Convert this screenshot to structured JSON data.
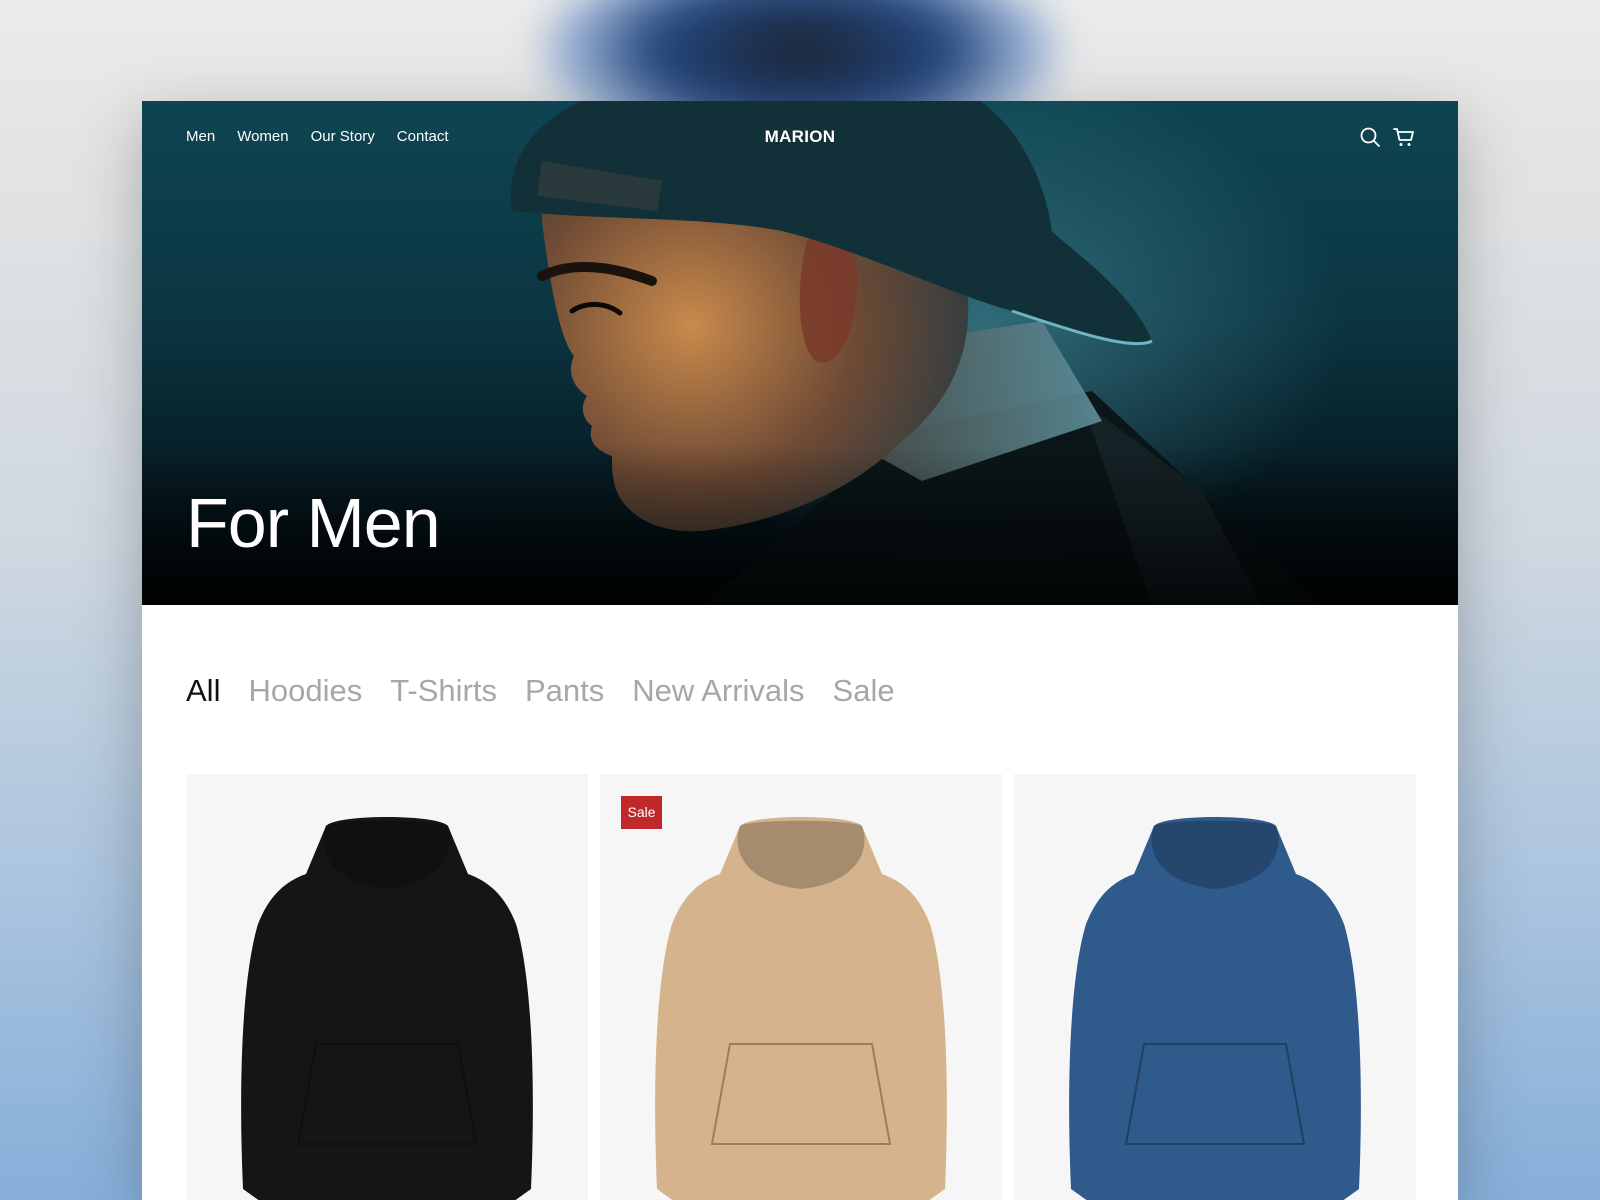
{
  "site": {
    "brand": "MARION",
    "nav": [
      {
        "label": "Men"
      },
      {
        "label": "Women"
      },
      {
        "label": "Our Story"
      },
      {
        "label": "Contact"
      }
    ],
    "icons": [
      "search-icon",
      "cart-icon"
    ]
  },
  "hero": {
    "title": "For Men"
  },
  "filters": {
    "tabs": [
      {
        "label": "All",
        "active": true
      },
      {
        "label": "Hoodies",
        "active": false
      },
      {
        "label": "T-Shirts",
        "active": false
      },
      {
        "label": "Pants",
        "active": false
      },
      {
        "label": "New Arrivals",
        "active": false
      },
      {
        "label": "Sale",
        "active": false
      }
    ]
  },
  "products": [
    {
      "color_name": "black",
      "color": "#151515",
      "badge": ""
    },
    {
      "color_name": "beige",
      "color": "#d5b48d",
      "badge": "Sale"
    },
    {
      "color_name": "blue",
      "color": "#2f5a8c",
      "badge": ""
    }
  ],
  "colors": {
    "sale_badge": "#c0282a",
    "tab_active": "#111111",
    "tab_inactive": "#a7a7a7"
  }
}
